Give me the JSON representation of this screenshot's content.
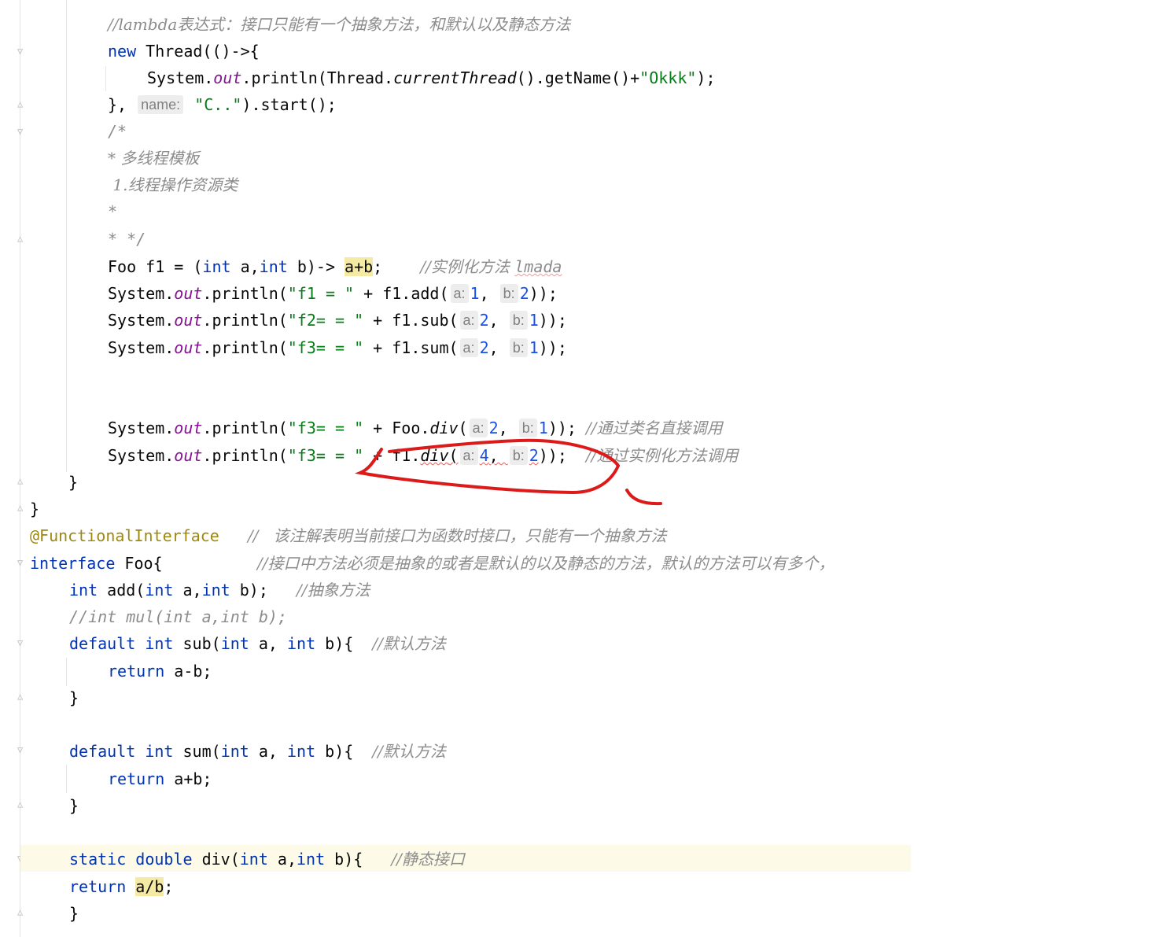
{
  "editor": {
    "lines": {
      "l1_comment": "//lambda表达式：接口只能有一个抽象方法，和默认以及静态方法",
      "l2_new": "new",
      "l2_rest": " Thread(()->{",
      "l3_prefix": "System.",
      "l3_out": "out",
      "l3_mid": ".println(Thread.",
      "l3_current": "currentThread",
      "l3_after": "().getName()+",
      "l3_str": "\"Okkk\"",
      "l3_end": ");",
      "l4_start": "}, ",
      "l4_hint": "name:",
      "l4_str": "\"C..\"",
      "l4_end": ").start();",
      "l5": "/*",
      "l6": "* 多线程模板",
      "l7": " 1.线程操作资源类",
      "l8": "*",
      "l9": "* */",
      "l10_a": "Foo f1 = (",
      "l10_int1": "int",
      "l10_b": " a,",
      "l10_int2": "int",
      "l10_c": " b)-> ",
      "l10_hl": "a+b",
      "l10_d": ";    ",
      "l10_cmt": "//实例化方法 ",
      "l10_cmt2": "lmada",
      "p1_str": "\"f1 = \"",
      "p1_call": " + f1.add(",
      "p1_arg1": "1",
      "p1_arg2": "2",
      "p1_end": "));",
      "p2_str": "\"f2= = \"",
      "p2_call": " + f1.sub(",
      "p2_arg1": "2",
      "p2_arg2": "1",
      "p2_end": "));",
      "p3_str": "\"f3= = \"",
      "p3_call": " + f1.sum(",
      "p3_arg1": "2",
      "p3_arg2": "1",
      "p3_end": "));",
      "p4_str": "\"f3= = \"",
      "p4_call": " + Foo.",
      "p4_div": "div",
      "p4_arg1": "2",
      "p4_arg2": "1",
      "p4_end": "));",
      "p4_cmt": "//通过类名直接调用",
      "p5_str": "\"f3= = \"",
      "p5_call": " + f1.",
      "p5_div": "div",
      "p5_arg1": "4",
      "p5_arg2": "2",
      "p5_end": "));",
      "p5_cmt": "//通过实例化方法调用",
      "sys": "System.",
      "out": "out",
      "println": ".println(",
      "hint_a": "a:",
      "hint_b": "b:",
      "comma": ", ",
      "close_brace": "}",
      "ann": "@FunctionalInterface",
      "ann_cmt": "//   该注解表明当前接口为函数时接口，只能有一个抽象方法",
      "iface_kw": "interface",
      "iface_name": " Foo{",
      "iface_cmt": "//接口中方法必须是抽象的或者是默认的以及静态的方法，默认的方法可以有多个，",
      "add_int": "int",
      "add_name": " add(",
      "add_int2": "int",
      "add_a": " a,",
      "add_int3": "int",
      "add_b": " b);",
      "add_cmt": "//抽象方法",
      "mul_cmt": "//int mul(int a,int b);",
      "default_kw": "default",
      "int_kw": "int",
      "sub_name": "sub(",
      "sum_name": "sum(",
      "arg_a": " a, ",
      "arg_b": " b){",
      "default_cmt": "//默认方法",
      "return_kw": "return",
      "ret_sub": " a-b;",
      "ret_sum": " a+b;",
      "static_kw": "static",
      "double_kw": "double",
      "div_name": "div(",
      "div_a": " a,",
      "div_b": " b){",
      "static_cmt": "//静态接口",
      "ret_div": "a/b",
      "semi": ";"
    },
    "annotation_color": "#dd1a1a"
  }
}
